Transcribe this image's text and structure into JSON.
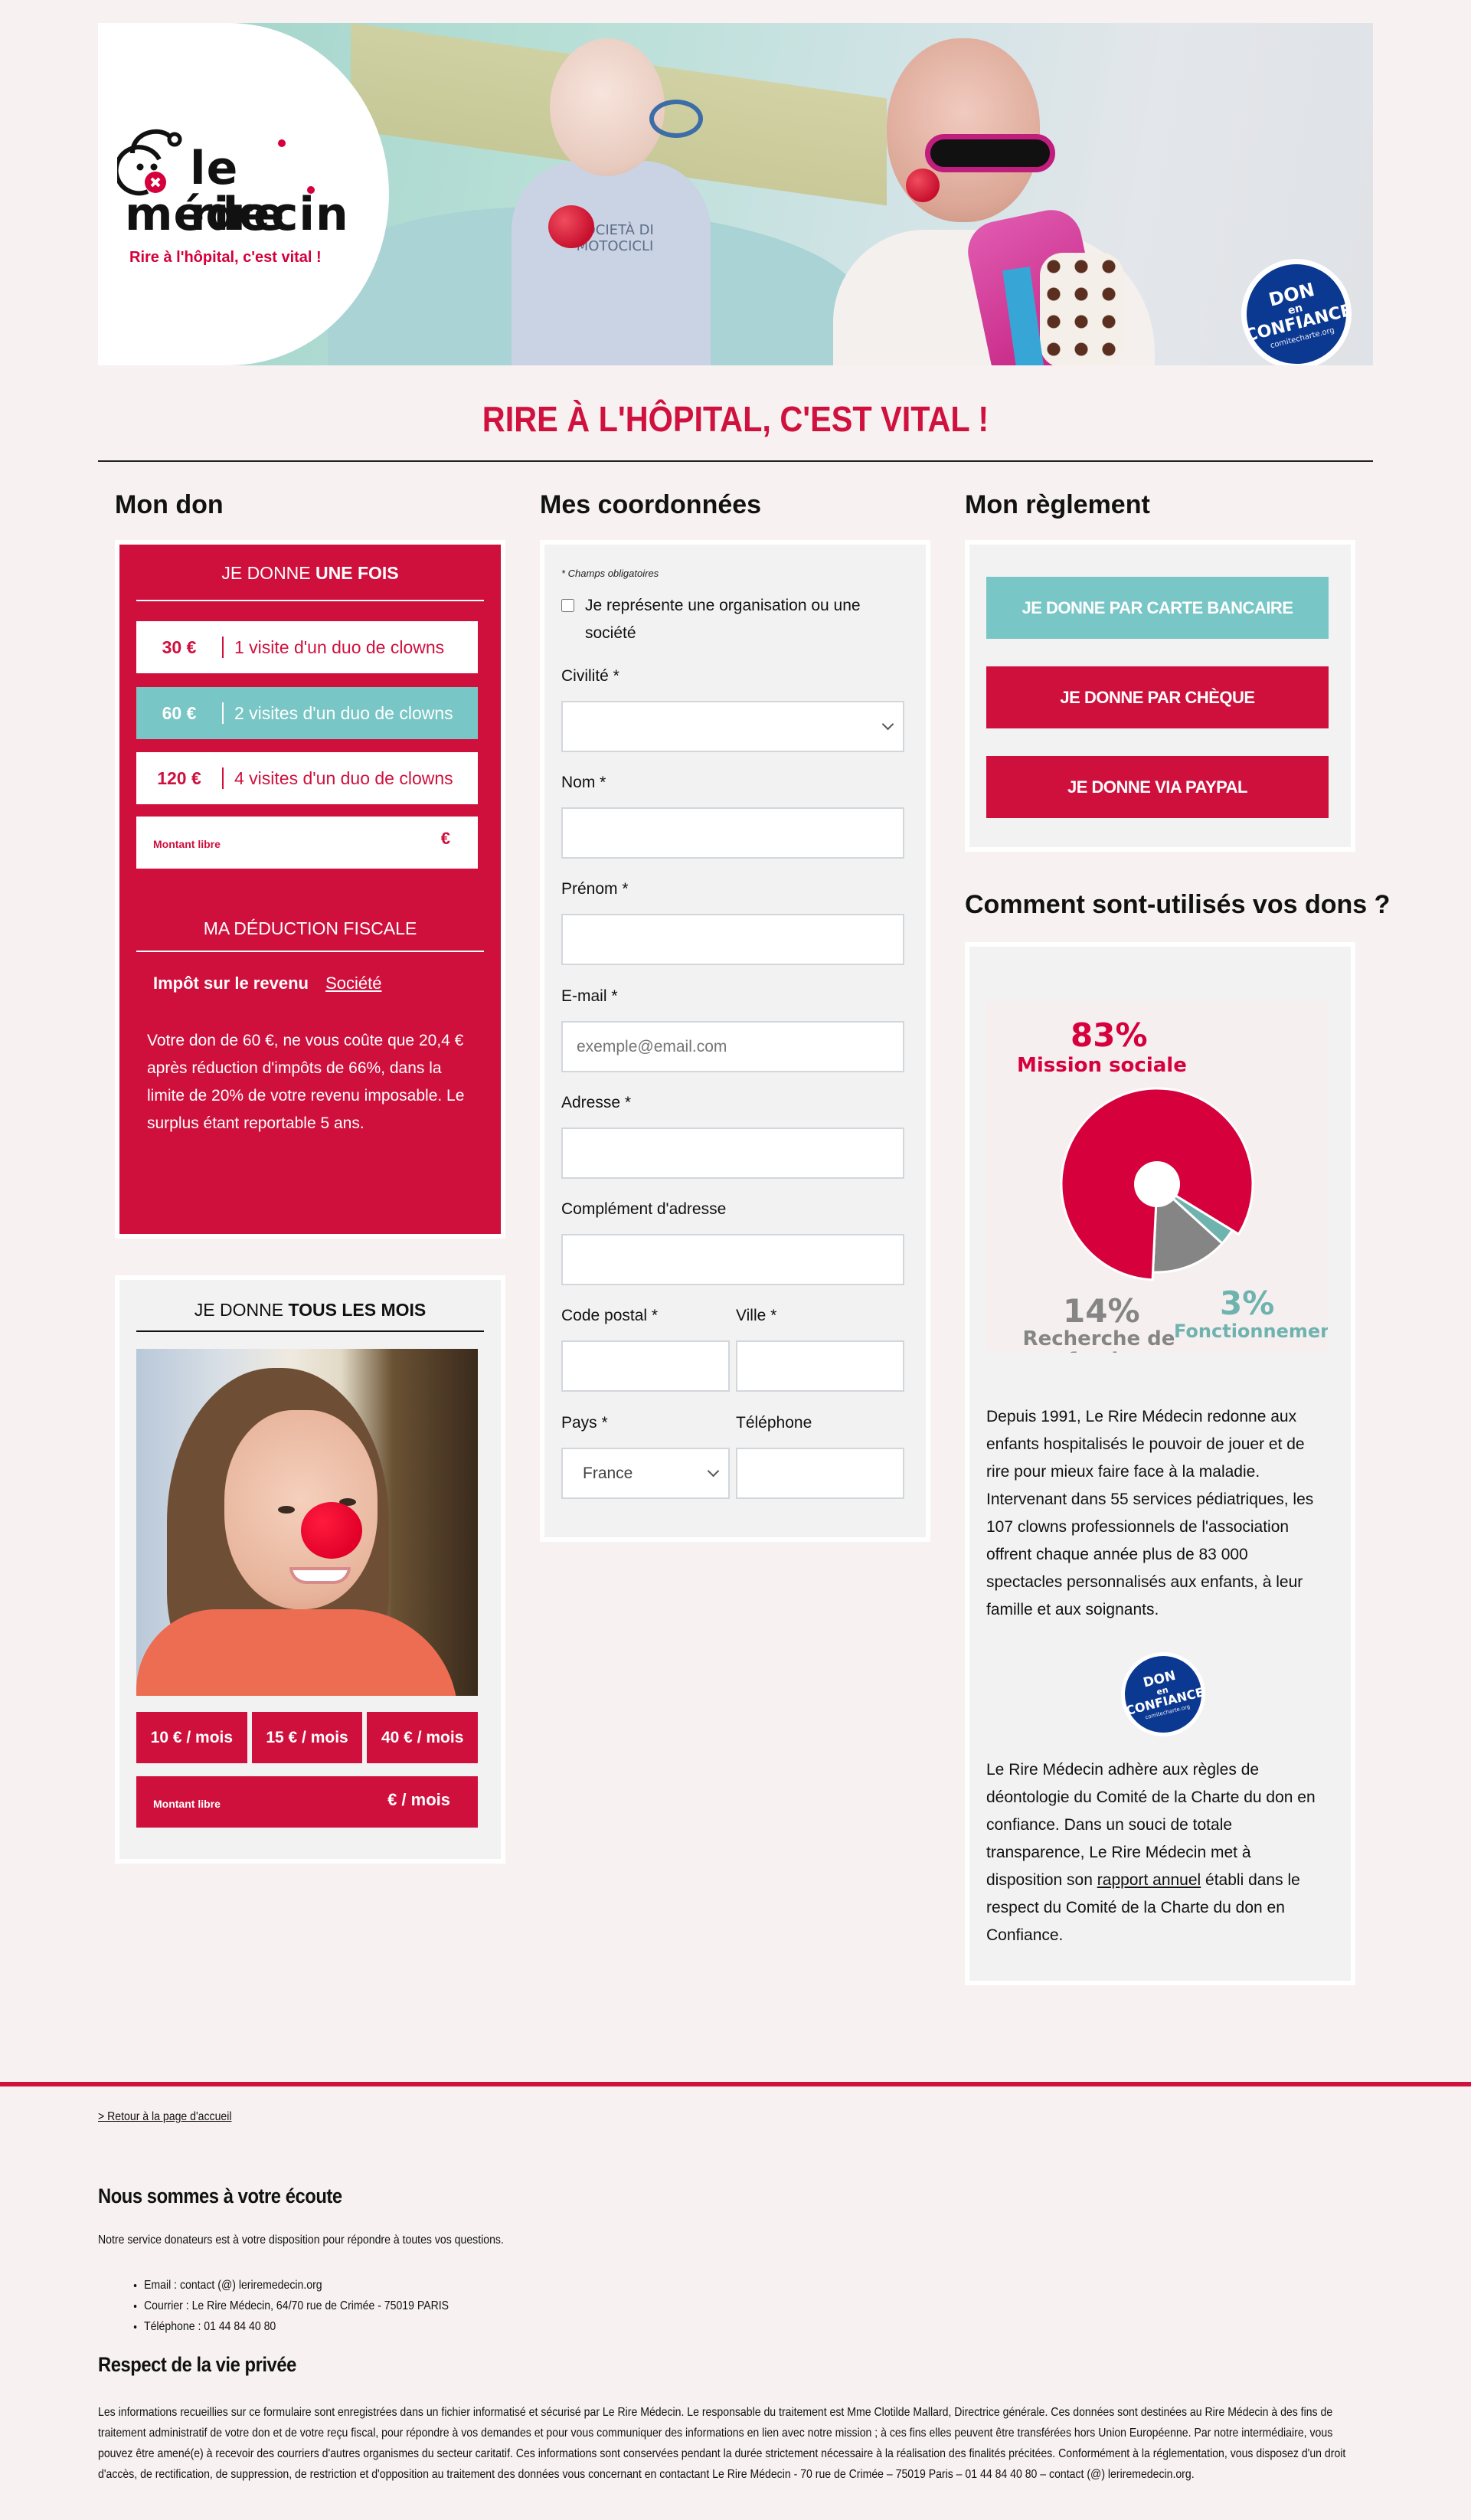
{
  "hero": {
    "logo": {
      "line1": "le rire",
      "line2": "médecin",
      "tagline": "Rire à l'hôpital, c'est vital !"
    },
    "shirt_text": "SOCIETÀ DI MOTOCICLI",
    "badge": {
      "line1": "DON",
      "line2": "en",
      "line3": "CONFIANCE",
      "line4": "comitecharte.org"
    }
  },
  "slogan": "RIRE À L'HÔPITAL, C'EST VITAL !",
  "columns": {
    "don": {
      "title_light": "Mon",
      "title_bold": "don"
    },
    "coordonnees": {
      "title_light": "Mes",
      "title_bold": "coordonnées"
    },
    "reglement": {
      "title_light": "Mon",
      "title_bold": "règlement"
    }
  },
  "once": {
    "title_light": "JE DONNE",
    "title_bold": "UNE FOIS",
    "amounts": [
      {
        "value": "30 €",
        "desc": "1 visite d'un duo de clowns",
        "selected": false
      },
      {
        "value": "60 €",
        "desc": "2 visites d'un duo de clowns",
        "selected": true
      },
      {
        "value": "120 €",
        "desc": "4 visites d'un duo de clowns",
        "selected": false
      }
    ],
    "free_label": "Montant libre",
    "free_currency": "€",
    "deduction_title": "MA DÉDUCTION FISCALE",
    "tabs": [
      "Impôt sur le revenu",
      "Société"
    ],
    "active_tab": "Impôt sur le revenu",
    "deduction_text": "Votre don de 60 €, ne vous coûte que 20,4 € après réduction d'impôts de 66%, dans la limite de 20% de votre revenu imposable. Le surplus étant reportable 5 ans."
  },
  "monthly": {
    "title_light": "JE DONNE",
    "title_bold": "TOUS LES MOIS",
    "amounts": [
      "10 € / mois",
      "15 € / mois",
      "40 € / mois"
    ],
    "free_label": "Montant libre",
    "free_currency": "€ / mois"
  },
  "form": {
    "required_note": "* Champs obligatoires",
    "org_checkbox": "Je représente une organisation ou une société",
    "org_checked": false,
    "fields": {
      "civilite": {
        "label": "Civilité *",
        "value": ""
      },
      "nom": {
        "label": "Nom *",
        "value": ""
      },
      "prenom": {
        "label": "Prénom *",
        "value": ""
      },
      "email": {
        "label": "E-mail *",
        "placeholder": "exemple@email.com",
        "value": ""
      },
      "adresse": {
        "label": "Adresse *",
        "value": ""
      },
      "complement": {
        "label": "Complément d'adresse",
        "value": ""
      },
      "code_postal": {
        "label": "Code postal *",
        "value": ""
      },
      "ville": {
        "label": "Ville *",
        "value": ""
      },
      "pays": {
        "label": "Pays *",
        "value": "France"
      },
      "telephone": {
        "label": "Téléphone",
        "value": ""
      }
    }
  },
  "payment": {
    "buttons": [
      "JE DONNE PAR CARTE BANCAIRE",
      "JE DONNE PAR CHÈQUE",
      "JE DONNE VIA PAYPAL"
    ]
  },
  "usage": {
    "title": "Comment sont-utilisés vos dons ?",
    "text": "Depuis 1991, Le Rire Médecin redonne aux enfants hospitalisés le pouvoir de jouer et de rire pour mieux faire face à la maladie. Intervenant dans 55 services pédiatriques, les 107 clowns professionnels de l'association offrent chaque année plus de 83 000 spectacles personnalisés aux enfants, à leur famille et aux soignants.",
    "charte_before": "Le Rire Médecin adhère aux règles de déontologie du Comité de la Charte du don en confiance. Dans un souci de totale transparence, Le Rire Médecin met à disposition son ",
    "charte_link": "rapport annuel",
    "charte_after": " établi dans le respect du Comité de la Charte du don en Confiance."
  },
  "chart_data": {
    "type": "pie",
    "title": "",
    "categories": [
      "Mission sociale",
      "Recherche de fonds",
      "Fonctionnement"
    ],
    "values": [
      83,
      14,
      3
    ],
    "labels": [
      "83%",
      "14%",
      "3%"
    ],
    "colors": [
      "#d6003d",
      "#858585",
      "#6fb3af"
    ],
    "donut_hole": true
  },
  "footer": {
    "back_link": "> Retour à la page d'accueil",
    "contact_title": "Nous sommes à votre écoute",
    "contact_intro": "Notre service donateurs est à votre disposition pour répondre à toutes vos questions.",
    "contact_items": [
      "Email : contact (@) leriremedecin.org",
      "Courrier : Le Rire Médecin, 64/70 rue de Crimée - 75019 PARIS",
      "Téléphone : 01 44 84 40 80"
    ],
    "privacy_title": "Respect de la vie privée",
    "privacy_text": "Les informations recueillies sur ce formulaire sont enregistrées dans un fichier informatisé et sécurisé par Le Rire Médecin. Le responsable du traitement est Mme Clotilde Mallard, Directrice générale. Ces données sont destinées au Rire Médecin à des fins de traitement administratif de votre don et de votre reçu fiscal, pour répondre à vos demandes et pour vous communiquer des informations en lien avec notre mission ; à ces fins elles peuvent être transférées hors Union Européenne. Par notre intermédiaire, vous pouvez être amené(e) à recevoir des courriers d'autres organismes du secteur caritatif. Ces informations sont conservées pendant la durée strictement nécessaire à la réalisation des finalités précitées. Conformément à la réglementation, vous disposez d'un droit d'accès, de rectification, de suppression, de restriction et d'opposition au traitement des données vous concernant en contactant Le Rire Médecin - 70 rue de Crimée – 75019 Paris – 01 44 84 40 80 – contact (@) leriremedecin.org."
  },
  "colors": {
    "brand_red": "#cf103d",
    "teal": "#79c6c6",
    "badge_blue": "#0b3891",
    "page_bg": "#f7f1f1"
  }
}
